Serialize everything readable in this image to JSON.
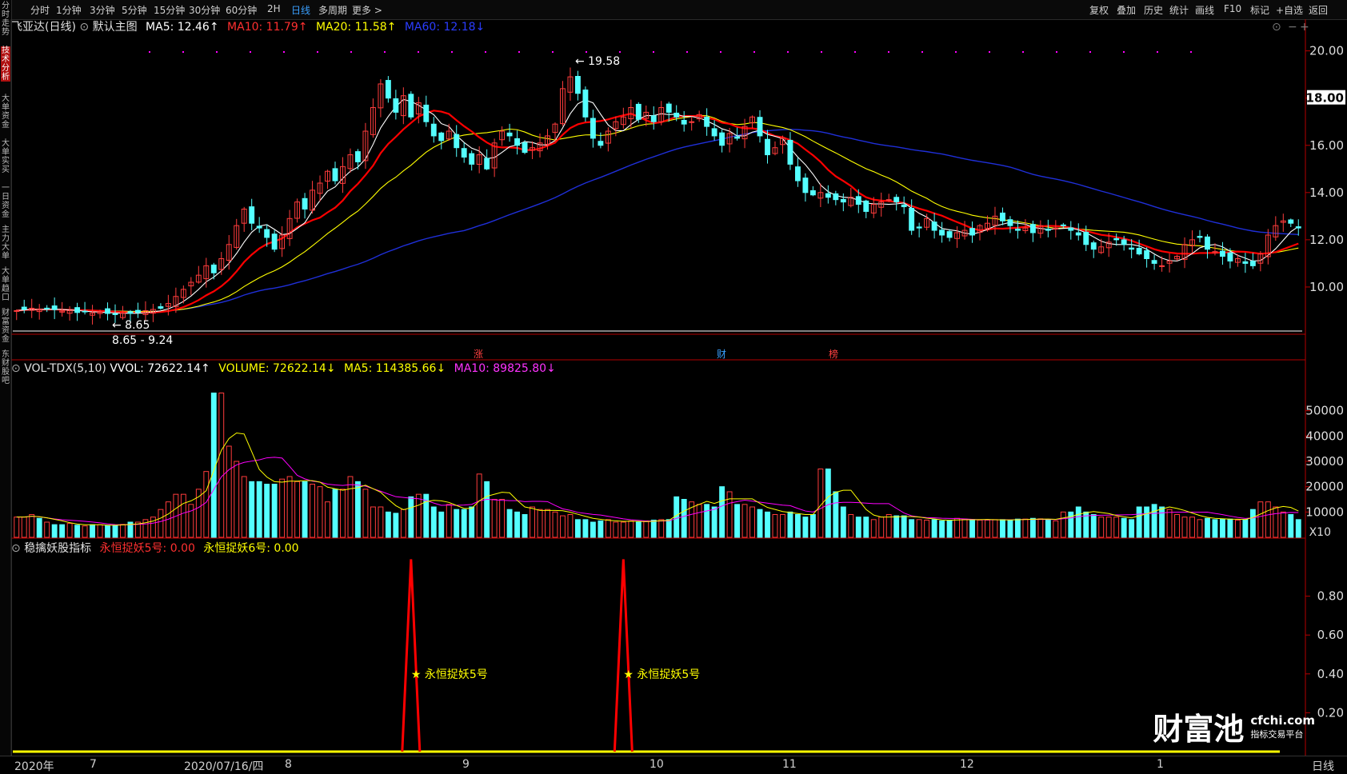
{
  "colors": {
    "up": "#ff3c3c",
    "down": "#54ffff",
    "ma5": "#ffffff",
    "ma10": "#ff0000",
    "ma20": "#ffff00",
    "ma60": "#1f2fd8",
    "grid": "#b40000",
    "yellow": "#ffff00",
    "magenta": "#ff00ff"
  },
  "toolbar": {
    "left": [
      "分时",
      "1分钟",
      "3分钟",
      "5分钟",
      "15分钟",
      "30分钟",
      "60分钟",
      "2H",
      "日线",
      "多周期",
      "更多 >"
    ],
    "active": "日线",
    "right": [
      "复权",
      "叠加",
      "历史",
      "统计",
      "画线",
      "F10",
      "标记",
      "+自选",
      "返回"
    ]
  },
  "side_tabs": [
    "分时走势",
    "技术分析",
    "大单资金",
    "大单实买",
    "一日资金",
    "主力大单",
    "大单趋口",
    "财富资金",
    "东财股吧"
  ],
  "main": {
    "title": "飞亚达(日线)",
    "template": "默认主图",
    "ma5": "MA5: 12.46↑",
    "ma10": "MA10: 11.79↑",
    "ma20": "MA20: 11.58↑",
    "ma60": "MA60: 12.18↓",
    "y_ticks": [
      "20.00",
      "18.00",
      "16.00",
      "14.00",
      "12.00",
      "10.00"
    ],
    "current_price": "18.00",
    "high_label": "19.58",
    "low_label": "8.65",
    "range_label": "8.65 - 9.24",
    "events": [
      "涨",
      "财",
      "榜"
    ]
  },
  "vol": {
    "title": "VOL-TDX(5,10)",
    "vvol": "VVOL: 72622.14↑",
    "volume": "VOLUME: 72622.14↓",
    "ma5": "MA5: 114385.66↓",
    "ma10": "MA10: 89825.80↓",
    "y_ticks": [
      "50000",
      "40000",
      "30000",
      "20000",
      "10000"
    ],
    "unit": "X10"
  },
  "ind": {
    "title": "稳擒妖股指标",
    "s5": "永恒捉妖5号: 0.00",
    "s6": "永恒捉妖6号: 0.00",
    "y_ticks": [
      "0.80",
      "0.60",
      "0.40",
      "0.20"
    ],
    "signal_label": "★ 永恒捉妖5号"
  },
  "x_axis": {
    "labels": [
      "2020年",
      "7",
      "2020/07/16/四",
      "8",
      "9",
      "10",
      "11",
      "12",
      "1"
    ],
    "period": "日线"
  },
  "watermark": {
    "brand": "财富池",
    "domain": "cfchi.com",
    "tagline": "指标交易平台"
  },
  "chart_data": {
    "type": "candlestick",
    "closes": [
      9.0,
      9.05,
      9.1,
      9.03,
      9.08,
      9.04,
      8.98,
      9.0,
      8.92,
      8.95,
      8.9,
      8.93,
      8.88,
      8.85,
      8.9,
      8.88,
      8.92,
      9.0,
      9.05,
      9.1,
      9.3,
      9.6,
      9.9,
      10.2,
      10.5,
      10.9,
      10.6,
      11.2,
      11.8,
      12.6,
      13.3,
      12.7,
      12.5,
      12.1,
      11.6,
      12.2,
      12.9,
      13.6,
      13.3,
      14.1,
      14.4,
      14.9,
      14.5,
      15.1,
      15.6,
      15.3,
      16.6,
      17.6,
      18.6,
      18.0,
      17.4,
      18.1,
      17.2,
      17.8,
      17.0,
      16.4,
      16.2,
      16.6,
      15.9,
      15.5,
      15.2,
      15.6,
      15.0,
      16.1,
      16.6,
      16.4,
      16.0,
      15.7,
      15.9,
      16.1,
      16.4,
      16.9,
      18.4,
      18.9,
      18.2,
      17.2,
      16.3,
      16.0,
      16.6,
      17.0,
      17.2,
      17.6,
      17.1,
      17.4,
      17.0,
      17.6,
      17.4,
      17.2,
      16.9,
      17.0,
      17.3,
      16.8,
      16.4,
      16.0,
      16.5,
      16.3,
      16.8,
      17.2,
      16.4,
      15.6,
      15.9,
      16.3,
      15.2,
      14.5,
      14.0,
      13.9,
      14.0,
      13.8,
      13.7,
      13.6,
      13.8,
      13.5,
      13.2,
      13.5,
      13.6,
      13.7,
      13.6,
      13.4,
      12.4,
      12.5,
      12.9,
      12.4,
      12.2,
      12.1,
      12.3,
      12.4,
      12.2,
      12.6,
      12.7,
      13.0,
      12.8,
      12.6,
      12.4,
      12.5,
      12.3,
      12.6,
      12.4,
      12.5,
      12.6,
      12.4,
      12.2,
      11.8,
      11.6,
      11.7,
      11.9,
      12.0,
      11.8,
      11.6,
      11.4,
      11.2,
      11.0,
      10.9,
      11.1,
      11.3,
      11.8,
      12.0,
      12.1,
      11.6,
      11.5,
      11.3,
      11.1,
      11.2,
      11.0,
      10.9,
      11.4,
      12.2,
      12.6,
      12.8,
      12.7,
      12.5
    ],
    "volume_approx": [
      8000,
      9000,
      7500,
      6000,
      5000,
      5500,
      4800,
      4500,
      5000,
      4600,
      4700,
      5100,
      6000,
      7000,
      8000,
      11000,
      14000,
      17000,
      13000,
      19000,
      26000,
      57000,
      36000,
      30000,
      24000,
      22000,
      21000,
      21000,
      23000,
      24000,
      22000,
      21000,
      20000,
      14000,
      19000,
      24000,
      22000,
      19000,
      12000,
      10000,
      9500,
      11000,
      16000,
      17000,
      12000,
      10000,
      13000,
      11000,
      12000,
      25000,
      22000,
      15000,
      11000,
      10000,
      9000,
      12000,
      11000,
      10000,
      8500,
      9000,
      7000,
      6000,
      6500,
      7000,
      6000,
      6500,
      6000,
      6500,
      6800,
      7000,
      16000,
      15000,
      14000,
      13000,
      12000,
      20000,
      18000,
      13000,
      12000,
      11000,
      10000,
      9000,
      10000,
      9000,
      8000,
      9000,
      27000,
      18000,
      12000,
      9000,
      8000,
      7000,
      8000,
      9000,
      8500,
      7000,
      7000,
      6800,
      7000,
      6500,
      7500,
      7200,
      7000,
      6800,
      7000,
      7000,
      6800,
      7200,
      7500,
      7300,
      7000,
      6500,
      10000,
      12000,
      10000,
      9000,
      8000,
      8000,
      7500,
      7000,
      12000,
      13000,
      12000,
      11000,
      9000,
      8000,
      7000,
      7500,
      7000,
      7200,
      6800,
      7000,
      11000,
      14000,
      12000,
      10000,
      9000,
      7000
    ],
    "signal_days": [
      52,
      80
    ]
  }
}
